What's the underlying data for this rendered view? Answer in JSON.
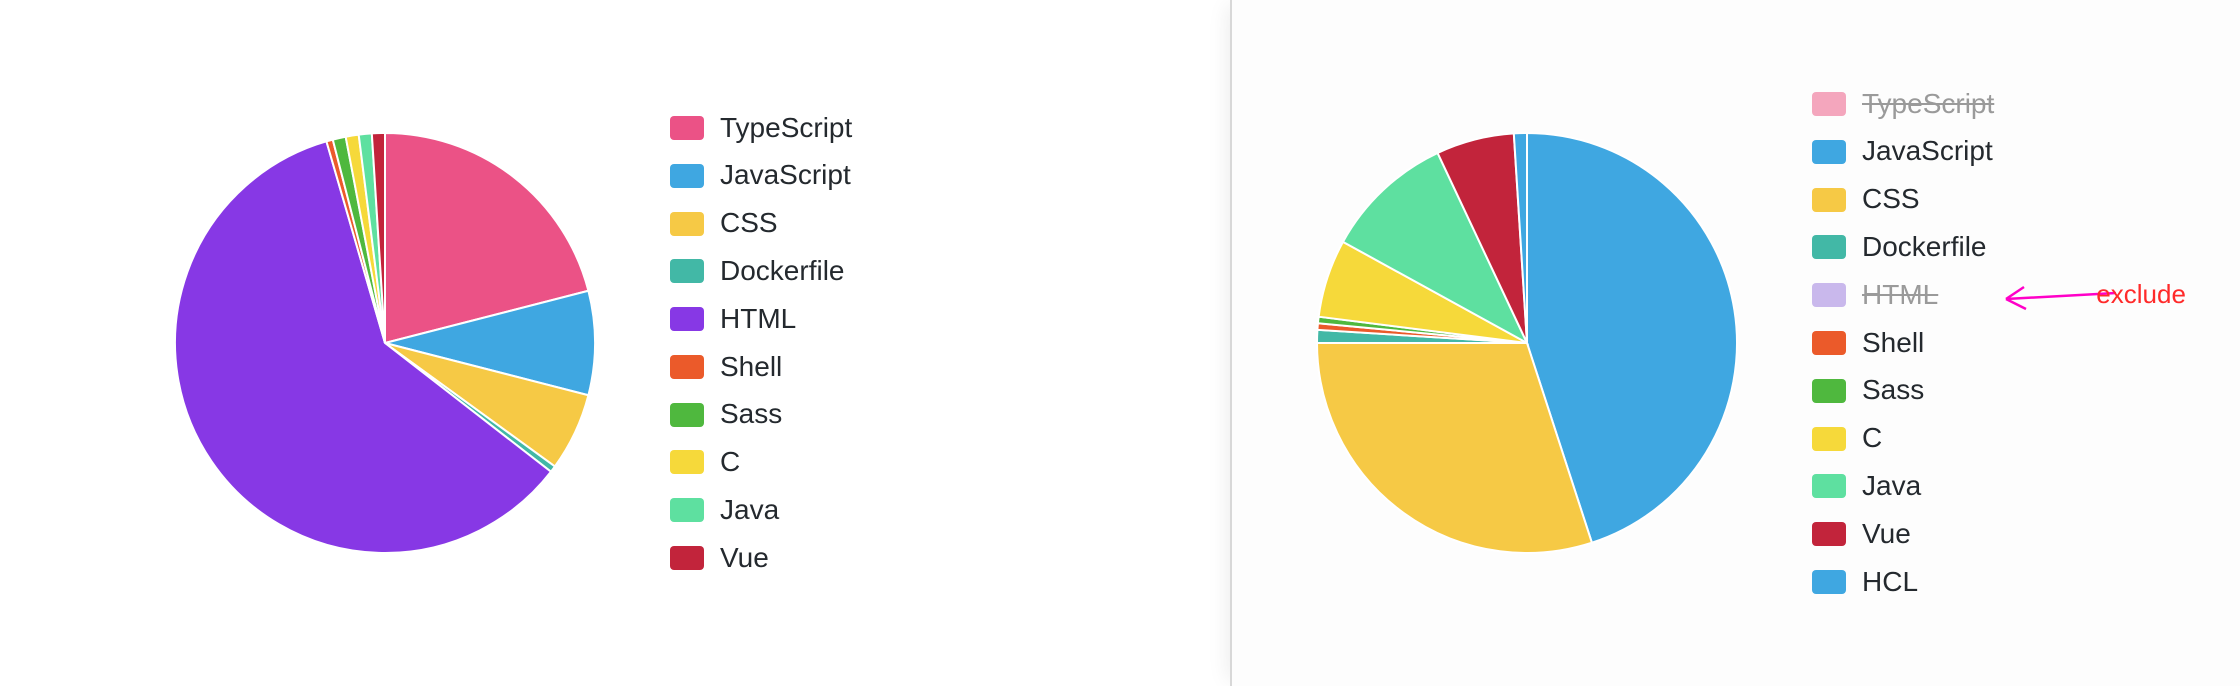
{
  "chart_data": [
    {
      "type": "pie",
      "title": "",
      "series": [
        {
          "name": "TypeScript",
          "value": 21,
          "color": "#eb5286",
          "excluded": false
        },
        {
          "name": "JavaScript",
          "value": 8,
          "color": "#3fa7e1",
          "excluded": false
        },
        {
          "name": "CSS",
          "value": 6,
          "color": "#f6c945",
          "excluded": false
        },
        {
          "name": "Dockerfile",
          "value": 0.5,
          "color": "#42b8a6",
          "excluded": false
        },
        {
          "name": "HTML",
          "value": 60,
          "color": "#8738e5",
          "excluded": false
        },
        {
          "name": "Shell",
          "value": 0.5,
          "color": "#eb5a2a",
          "excluded": false
        },
        {
          "name": "Sass",
          "value": 1,
          "color": "#4fb83e",
          "excluded": false
        },
        {
          "name": "C",
          "value": 1,
          "color": "#f6d93a",
          "excluded": false
        },
        {
          "name": "Java",
          "value": 1,
          "color": "#5ee0a0",
          "excluded": false
        },
        {
          "name": "Vue",
          "value": 1,
          "color": "#c2243b",
          "excluded": false
        }
      ]
    },
    {
      "type": "pie",
      "title": "",
      "series": [
        {
          "name": "TypeScript",
          "value": 0,
          "color": "#f4a6bd",
          "excluded": true
        },
        {
          "name": "JavaScript",
          "value": 45,
          "color": "#3fa7e1",
          "excluded": false
        },
        {
          "name": "CSS",
          "value": 30,
          "color": "#f6c945",
          "excluded": false
        },
        {
          "name": "Dockerfile",
          "value": 1,
          "color": "#42b8a6",
          "excluded": false
        },
        {
          "name": "HTML",
          "value": 0,
          "color": "#c9b8ec",
          "excluded": true
        },
        {
          "name": "Shell",
          "value": 0.5,
          "color": "#eb5a2a",
          "excluded": false
        },
        {
          "name": "Sass",
          "value": 0.5,
          "color": "#4fb83e",
          "excluded": false
        },
        {
          "name": "C",
          "value": 6,
          "color": "#f6d93a",
          "excluded": false
        },
        {
          "name": "Java",
          "value": 10,
          "color": "#5ee0a0",
          "excluded": false
        },
        {
          "name": "Vue",
          "value": 6,
          "color": "#c2243b",
          "excluded": false
        },
        {
          "name": "HCL",
          "value": 1,
          "color": "#3fa7e1",
          "excluded": false
        }
      ]
    }
  ],
  "annotation": {
    "text": "exclude"
  }
}
